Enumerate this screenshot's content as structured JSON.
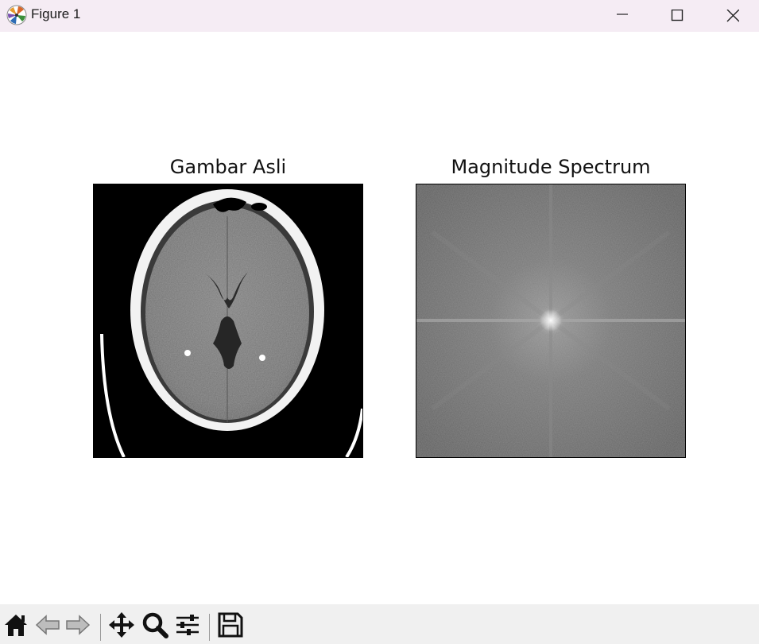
{
  "window": {
    "title": "Figure 1",
    "icons": {
      "app": "matplotlib-logo-icon",
      "minimize": "minimize-icon",
      "maximize": "maximize-icon",
      "close": "close-icon"
    }
  },
  "figure": {
    "subplots": [
      {
        "title": "Gambar Asli",
        "content": "ct-brain-scan-image"
      },
      {
        "title": "Magnitude Spectrum",
        "content": "fft-magnitude-spectrum-image"
      }
    ]
  },
  "toolbar": {
    "buttons": [
      {
        "icon": "home-icon",
        "enabled": true
      },
      {
        "icon": "back-arrow-icon",
        "enabled": false
      },
      {
        "icon": "forward-arrow-icon",
        "enabled": false
      },
      {
        "icon": "pan-move-icon",
        "enabled": true
      },
      {
        "icon": "zoom-magnifier-icon",
        "enabled": true
      },
      {
        "icon": "configure-subplots-icon",
        "enabled": true
      },
      {
        "icon": "save-floppy-icon",
        "enabled": true
      }
    ]
  }
}
